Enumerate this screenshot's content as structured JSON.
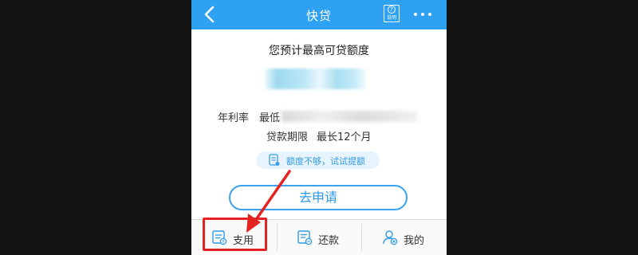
{
  "header": {
    "title": "快贷",
    "back_icon": "chevron-left-icon",
    "help_label": "说明",
    "help_symbol": "?",
    "more_icon": "more-dots-icon",
    "bg_color": "#2fa1f2"
  },
  "main": {
    "subtitle": "您预计最高可贷额度",
    "rate_label": "年利率",
    "rate_value": "最低",
    "term_label": "贷款期限",
    "term_value": "最长12个月",
    "raise_text": "额度不够，试试提额",
    "apply_label": "去申请"
  },
  "tabbar": {
    "items": [
      {
        "label": "支用",
        "icon": "withdraw-icon"
      },
      {
        "label": "还款",
        "icon": "repay-icon"
      },
      {
        "label": "我的",
        "icon": "profile-icon"
      }
    ]
  },
  "annotation": {
    "color": "#e52222",
    "target": "支用"
  }
}
